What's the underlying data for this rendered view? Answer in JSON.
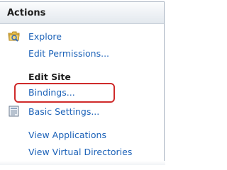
{
  "header": {
    "title": "Actions"
  },
  "items": {
    "explore": "Explore",
    "edit_permissions": "Edit Permissions...",
    "edit_site_heading": "Edit Site",
    "bindings": "Bindings...",
    "basic_settings": "Basic Settings...",
    "view_applications": "View Applications",
    "view_virtual_directories": "View Virtual Directories"
  },
  "icons": {
    "explore": "folder-explore-icon",
    "basic_settings": "settings-document-icon"
  },
  "colors": {
    "link": "#1c62b8",
    "highlight": "#cf2b2b"
  }
}
